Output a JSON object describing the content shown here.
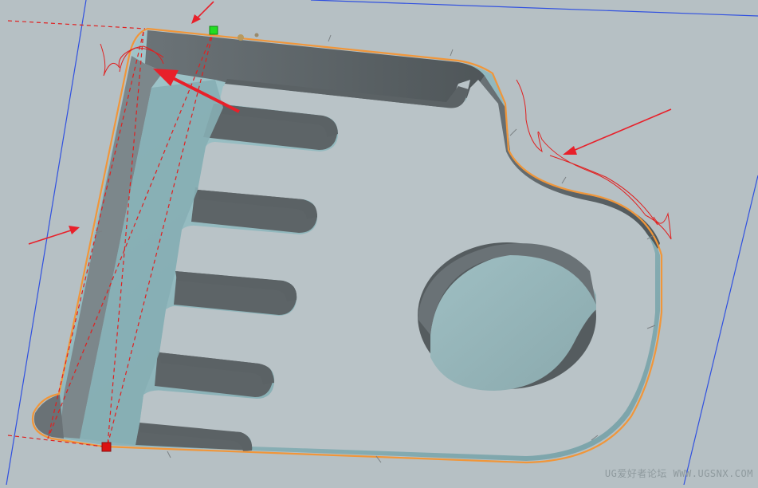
{
  "viewport": {
    "background": "#b6c0c4",
    "plate_top_color": "#b9c3c7",
    "wall_color": "#5d6467",
    "floor_color": "#8fb3b9",
    "boundary_color": "#f0963a",
    "datum_line_color": "#3050e0",
    "annotation_color": "#e02020",
    "start_marker_color": "#22dd22",
    "end_marker_color": "#dd1111"
  },
  "icons": {
    "start_marker": "green-square-icon",
    "end_marker": "red-square-icon",
    "annotation_arrow": "red-arrow-icon"
  },
  "watermark": "UG爱好者论坛 WWW.UGSNX.COM"
}
